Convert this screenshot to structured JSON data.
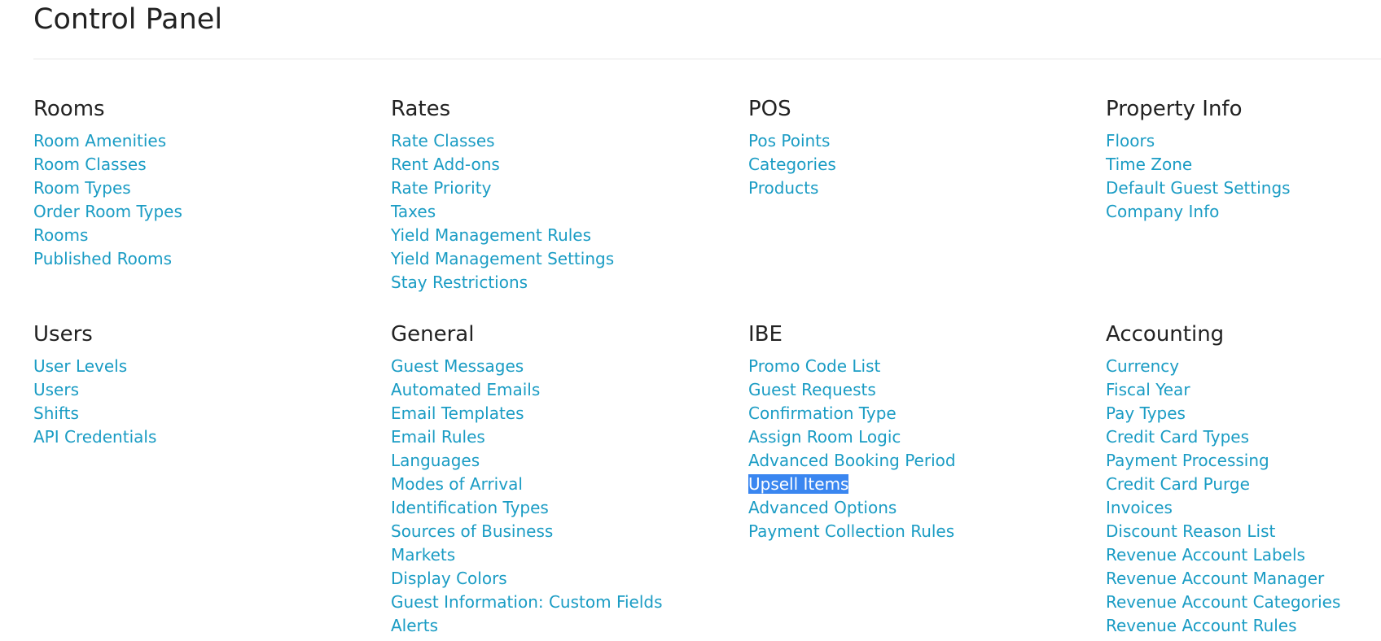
{
  "page": {
    "title": "Control Panel"
  },
  "colors": {
    "link": "#1a9cc4",
    "heading": "#222222",
    "selection_bg": "#3a86f0",
    "selection_text": "#ffffff"
  },
  "sections": [
    {
      "heading": "Rooms",
      "links": [
        "Room Amenities",
        "Room Classes",
        "Room Types",
        "Order Room Types",
        "Rooms",
        "Published Rooms"
      ]
    },
    {
      "heading": "Rates",
      "links": [
        "Rate Classes",
        "Rent Add-ons",
        "Rate Priority",
        "Taxes",
        "Yield Management Rules",
        "Yield Management Settings",
        "Stay Restrictions"
      ]
    },
    {
      "heading": "POS",
      "links": [
        "Pos Points",
        "Categories",
        "Products"
      ]
    },
    {
      "heading": "Property Info",
      "links": [
        "Floors",
        "Time Zone",
        "Default Guest Settings",
        "Company Info"
      ]
    },
    {
      "heading": "Users",
      "links": [
        "User Levels",
        "Users",
        "Shifts",
        "API Credentials"
      ]
    },
    {
      "heading": "General",
      "links": [
        "Guest Messages",
        "Automated Emails",
        "Email Templates",
        "Email Rules",
        "Languages",
        "Modes of Arrival",
        "Identification Types",
        "Sources of Business",
        "Markets",
        "Display Colors",
        "Guest Information: Custom Fields",
        "Alerts"
      ]
    },
    {
      "heading": "IBE",
      "links": [
        "Promo Code List",
        "Guest Requests",
        "Confirmation Type",
        "Assign Room Logic",
        "Advanced Booking Period",
        "Upsell Items",
        "Advanced Options",
        "Payment Collection Rules"
      ],
      "selected_link": "Upsell Items"
    },
    {
      "heading": "Accounting",
      "links": [
        "Currency",
        "Fiscal Year",
        "Pay Types",
        "Credit Card Types",
        "Payment Processing",
        "Credit Card Purge",
        "Invoices",
        "Discount Reason List",
        "Revenue Account Labels",
        "Revenue Account Manager",
        "Revenue Account Categories",
        "Revenue Account Rules"
      ]
    }
  ]
}
